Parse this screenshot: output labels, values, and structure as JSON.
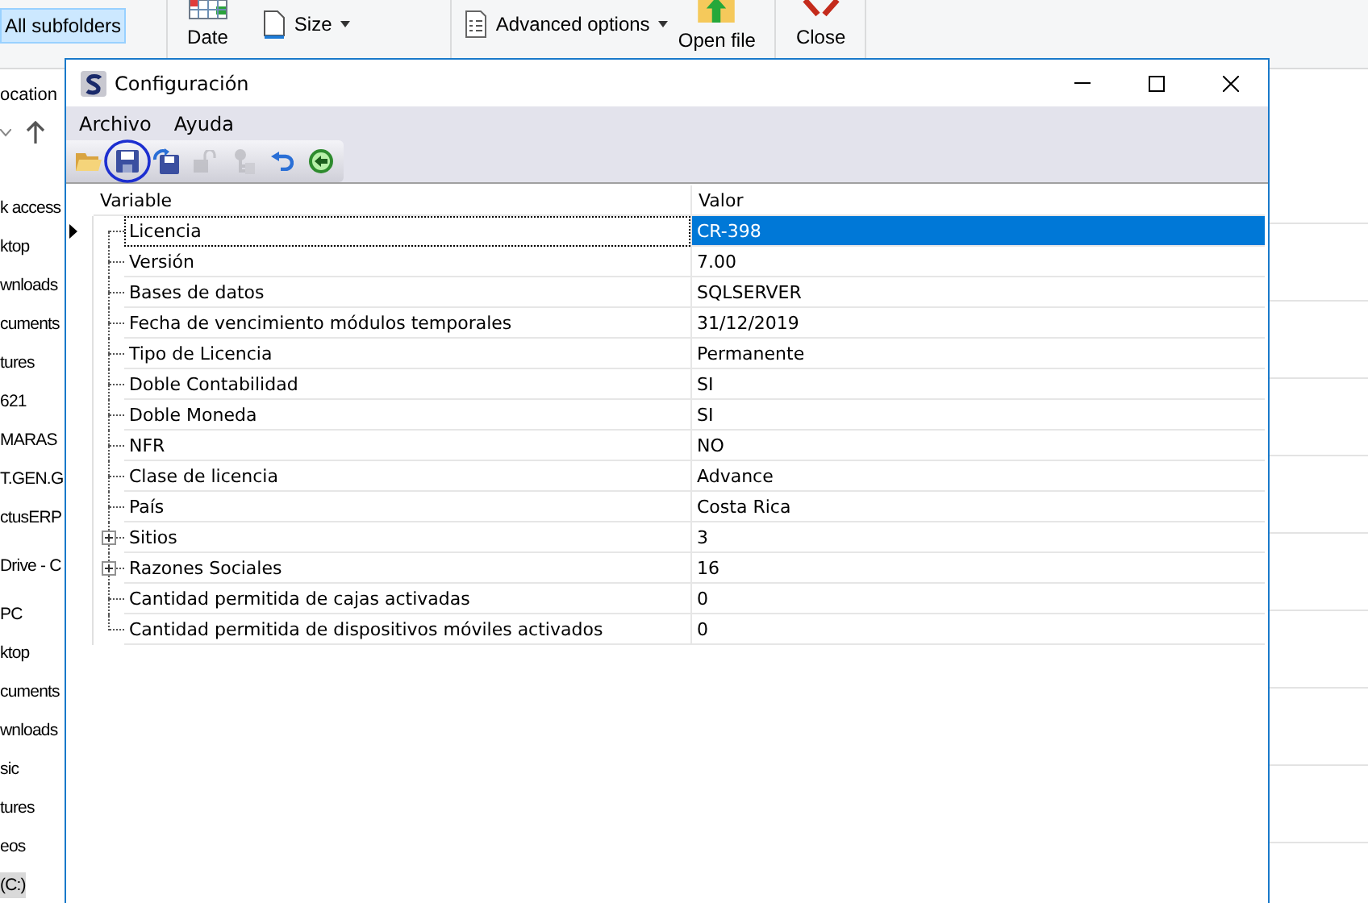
{
  "background": {
    "ribbon": [
      {
        "kind": "toggle",
        "label": "All subfolders",
        "selected": true
      },
      {
        "kind": "date",
        "label": "Date"
      },
      {
        "kind": "size",
        "label": "Size"
      },
      {
        "kind": "advanced",
        "label": "Advanced options"
      },
      {
        "kind": "open",
        "label": "Open file"
      },
      {
        "kind": "close",
        "label": "Close"
      }
    ],
    "location_label": "ocation",
    "nav_items": [
      {
        "label": "k access",
        "selected": false
      },
      {
        "label": "ktop",
        "selected": false
      },
      {
        "label": "wnloads",
        "selected": false
      },
      {
        "label": "cuments",
        "selected": false
      },
      {
        "label": "tures",
        "selected": false
      },
      {
        "label": "621",
        "selected": false
      },
      {
        "label": "MARAS",
        "selected": false
      },
      {
        "label": "T.GEN.G",
        "selected": false
      },
      {
        "label": "ctusERP",
        "selected": false
      },
      {
        "label": "Drive - C",
        "selected": false
      },
      {
        "label": "PC",
        "selected": false
      },
      {
        "label": "ktop",
        "selected": false
      },
      {
        "label": "cuments",
        "selected": false
      },
      {
        "label": "wnloads",
        "selected": false
      },
      {
        "label": "sic",
        "selected": false
      },
      {
        "label": "tures",
        "selected": false
      },
      {
        "label": "eos",
        "selected": false
      },
      {
        "label": "(C:)",
        "selected": true
      }
    ]
  },
  "window": {
    "title": "Configuración"
  },
  "menu": [
    "Archivo",
    "Ayuda"
  ],
  "toolbar": [
    {
      "kind": "open",
      "disabled": false,
      "circled": false
    },
    {
      "kind": "save",
      "disabled": false,
      "circled": true
    },
    {
      "kind": "save-reload",
      "disabled": false,
      "circled": false
    },
    {
      "kind": "lock",
      "disabled": true,
      "circled": false
    },
    {
      "kind": "key",
      "disabled": true,
      "circled": false
    },
    {
      "kind": "undo",
      "disabled": false,
      "circled": false
    },
    {
      "kind": "back",
      "disabled": false,
      "circled": false
    }
  ],
  "grid": {
    "columns": [
      "Variable",
      "Valor"
    ],
    "rows": [
      {
        "variable": "Licencia",
        "value": "CR-398",
        "selected": true,
        "expandable": false
      },
      {
        "variable": "Versión",
        "value": "7.00",
        "selected": false,
        "expandable": false
      },
      {
        "variable": "Bases de datos",
        "value": "SQLSERVER",
        "selected": false,
        "expandable": false
      },
      {
        "variable": "Fecha de vencimiento módulos temporales",
        "value": "31/12/2019",
        "selected": false,
        "expandable": false
      },
      {
        "variable": "Tipo de Licencia",
        "value": "Permanente",
        "selected": false,
        "expandable": false
      },
      {
        "variable": "Doble Contabilidad",
        "value": "SI",
        "selected": false,
        "expandable": false
      },
      {
        "variable": "Doble Moneda",
        "value": "SI",
        "selected": false,
        "expandable": false
      },
      {
        "variable": "NFR",
        "value": "NO",
        "selected": false,
        "expandable": false
      },
      {
        "variable": "Clase de licencia",
        "value": "Advance",
        "selected": false,
        "expandable": false
      },
      {
        "variable": "País",
        "value": "Costa Rica",
        "selected": false,
        "expandable": false
      },
      {
        "variable": "Sitios",
        "value": "3",
        "selected": false,
        "expandable": true
      },
      {
        "variable": "Razones Sociales",
        "value": "16",
        "selected": false,
        "expandable": true
      },
      {
        "variable": "Cantidad permitida de cajas activadas",
        "value": "0",
        "selected": false,
        "expandable": false
      },
      {
        "variable": "Cantidad permitida de dispositivos móviles activados",
        "value": "0",
        "selected": false,
        "expandable": false
      }
    ]
  }
}
